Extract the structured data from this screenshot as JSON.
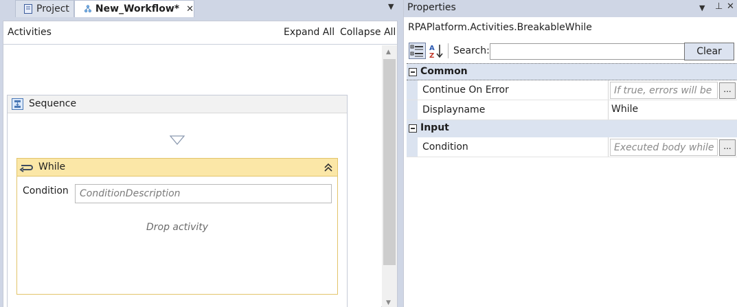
{
  "tabs": {
    "project": {
      "label": "Project",
      "icon": "document-icon"
    },
    "workflow": {
      "label": "New_Workflow*",
      "icon": "workflow-icon",
      "close": "✕"
    },
    "menu_glyph": "▼"
  },
  "canvas": {
    "activities_label": "Activities",
    "expand_all": "Expand All",
    "collapse_all": "Collapse All"
  },
  "sequence": {
    "title": "Sequence",
    "icon": "sequence-icon"
  },
  "while": {
    "title": "While",
    "icon": "loop-icon",
    "condition_label": "Condition",
    "condition_placeholder": "ConditionDescription",
    "drop_text": "Drop activity"
  },
  "properties": {
    "title": "Properties",
    "type_name": "RPAPlatform.Activities.BreakableWhile",
    "search_label": "Search:",
    "search_value": "",
    "clear_label": "Clear",
    "categories": [
      {
        "name": "Common",
        "rows": [
          {
            "name": "Continue On Error",
            "placeholder": "If true, errors will be ig",
            "value": ""
          },
          {
            "name": "Displayname",
            "value": "While"
          }
        ]
      },
      {
        "name": "Input",
        "rows": [
          {
            "name": "Condition",
            "placeholder": "Executed body while th",
            "value": ""
          }
        ]
      }
    ],
    "ellipsis": "...",
    "pin_glyph": "⊥",
    "close_glyph": "✕"
  },
  "colors": {
    "panel_bg": "#cfd6e5",
    "while_header": "#fbe7a7",
    "while_border": "#e2c46a",
    "category_bg": "#dbe3f0",
    "clear_button": "#dce3f0"
  }
}
